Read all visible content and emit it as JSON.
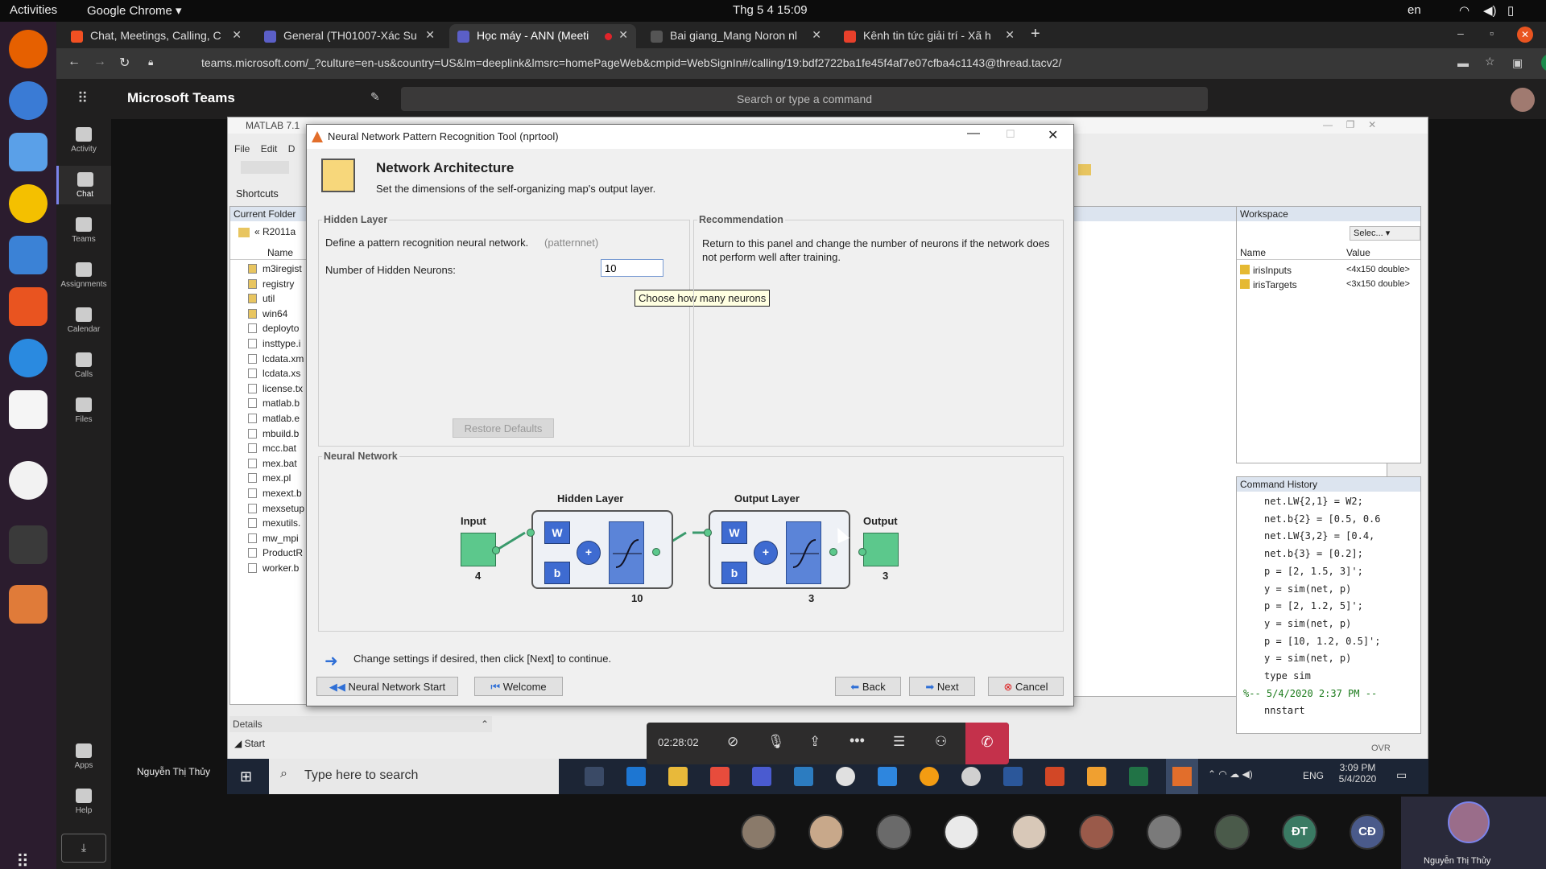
{
  "topbar": {
    "activities": "Activities",
    "app": "Google Chrome",
    "clock": "Thg 5 4  15:09",
    "lang": "en"
  },
  "chrome": {
    "tabs": [
      {
        "label": "Chat, Meetings, Calling, C",
        "color": "#f25022"
      },
      {
        "label": "General (TH01007-Xác Su",
        "color": "#5b5fc7"
      },
      {
        "label": "Học máy - ANN (Meeti",
        "color": "#5b5fc7"
      },
      {
        "label": "Bai giang_Mang Noron nl",
        "color": "#555555"
      },
      {
        "label": "Kênh tin tức giải trí - Xã h",
        "color": "#e8402b"
      }
    ],
    "url": "teams.microsoft.com/_?culture=en-us&country=US&lm=deeplink&lmsrc=homePageWeb&cmpid=WebSignIn#/calling/19:bdf2722ba1fe45f4af7e07cfba4c1143@thread.tacv2/",
    "profile_initial": "h"
  },
  "teams": {
    "app_name": "Microsoft Teams",
    "search_placeholder": "Search or type a command",
    "rail": [
      "Activity",
      "Chat",
      "Teams",
      "Assignments",
      "Calendar",
      "Calls",
      "Files"
    ],
    "rail_bottom": [
      "Apps",
      "Help"
    ],
    "presenter": "Nguyễn Thị Thủy",
    "self_name": "Nguyễn Thị Thủy",
    "call_timer": "02:28:02",
    "participant_initials": [
      "ĐT",
      "CĐ"
    ]
  },
  "matlab": {
    "title": "MATLAB 7.1",
    "menu": [
      "File",
      "Edit",
      "D"
    ],
    "shortcuts": "Shortcuts",
    "current_folder": "Current Folder",
    "folder_path": "R2011a",
    "name_col": "Name",
    "files": [
      "m3iregist",
      "registry",
      "util",
      "win64",
      "deployto",
      "insttype.i",
      "lcdata.xm",
      "lcdata.xs",
      "license.tx",
      "matlab.b",
      "matlab.e",
      "mbuild.b",
      "mcc.bat",
      "mex.bat",
      "mex.pl",
      "mexext.b",
      "mexsetup",
      "mexutils.",
      "mw_mpi",
      "ProductR",
      "worker.b"
    ],
    "details": "Details",
    "start": "Start",
    "workspace": {
      "title": "Workspace",
      "select": "Selec...",
      "cols": [
        "Name",
        "Value"
      ],
      "rows": [
        {
          "name": "irisInputs",
          "value": "<4x150 double>"
        },
        {
          "name": "irisTargets",
          "value": "<3x150 double>"
        }
      ]
    },
    "history": {
      "title": "Command History",
      "lines": [
        "net.LW{2,1} = W2;",
        "net.b{2} = [0.5, 0.6",
        "net.LW{3,2} = [0.4,",
        "net.b{3} = [0.2];",
        "p = [2, 1.5, 3]';",
        "y = sim(net, p)",
        "p = [2, 1.2, 5]';",
        "y = sim(net, p)",
        "p = [10, 1.2, 0.5]';",
        "y = sim(net, p)",
        "type sim",
        "%-- 5/4/2020 2:37 PM --",
        "nnstart"
      ]
    },
    "ovr": "OVR"
  },
  "windows_taskbar": {
    "search": "Type here to search",
    "lang": "ENG",
    "time": "3:09 PM",
    "date": "5/4/2020"
  },
  "dialog": {
    "title": "Neural Network Pattern Recognition Tool (nprtool)",
    "heading": "Network Architecture",
    "subheading": "Set the dimensions of the self-organizing map's output layer.",
    "hidden_group": "Hidden Layer",
    "define_text": "Define a pattern recognition neural network.",
    "define_fn": "(patternnet)",
    "neurons_label": "Number of Hidden Neurons:",
    "neurons_value": "10",
    "tooltip": "Choose how many neurons",
    "restore": "Restore Defaults",
    "recommend_group": "Recommendation",
    "recommend_text": "Return to this panel and change the number of neurons if the network does not perform well after training.",
    "nn_group": "Neural Network",
    "diagram": {
      "input": "Input",
      "input_n": "4",
      "hidden": "Hidden Layer",
      "hidden_n": "10",
      "output_layer": "Output Layer",
      "output_layer_n": "3",
      "output": "Output",
      "output_n": "3",
      "w": "W",
      "b": "b",
      "plus": "+"
    },
    "hint": "Change settings  if desired, then click [Next] to continue.",
    "btn_nnstart": "Neural Network Start",
    "btn_welcome": "Welcome",
    "btn_back": "Back",
    "btn_next": "Next",
    "btn_cancel": "Cancel"
  }
}
